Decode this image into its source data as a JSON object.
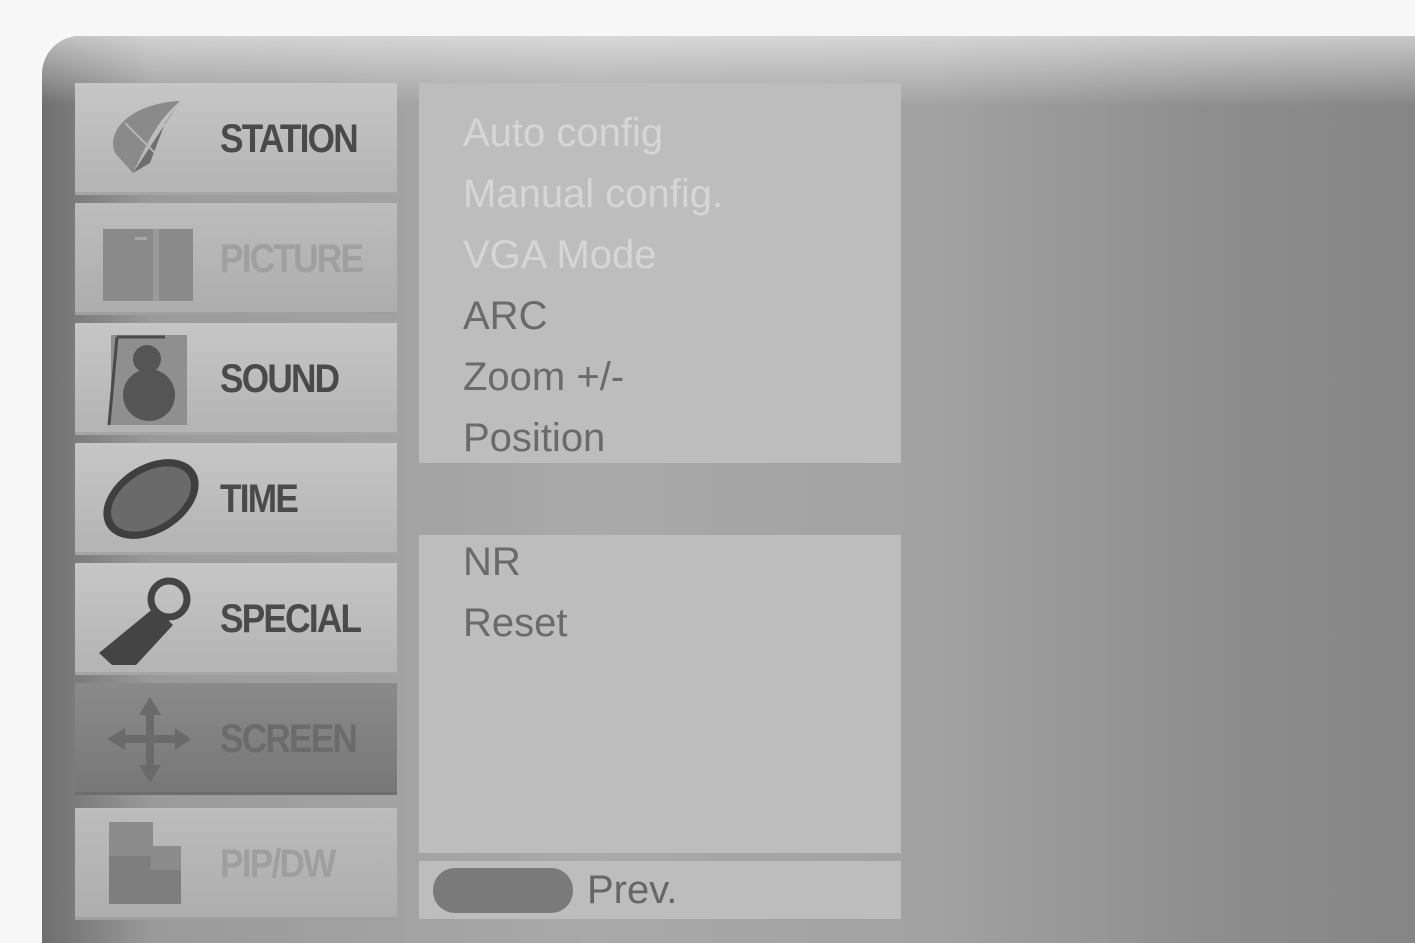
{
  "menu": {
    "items": [
      {
        "label": "STATION",
        "icon": "satellite-dish-icon",
        "state": "normal"
      },
      {
        "label": "PICTURE",
        "icon": "picture-monitor-icon",
        "state": "dim"
      },
      {
        "label": "SOUND",
        "icon": "speaker-icon",
        "state": "normal"
      },
      {
        "label": "TIME",
        "icon": "clock-disc-icon",
        "state": "normal"
      },
      {
        "label": "SPECIAL",
        "icon": "tag-icon",
        "state": "normal"
      },
      {
        "label": "SCREEN",
        "icon": "move-arrows-icon",
        "state": "active"
      },
      {
        "label": "PIP/DW",
        "icon": "pip-windows-icon",
        "state": "dim"
      }
    ]
  },
  "submenu": {
    "items": [
      {
        "label": "Auto config",
        "faded": true
      },
      {
        "label": "Manual config.",
        "faded": true
      },
      {
        "label": "VGA Mode",
        "faded": true
      },
      {
        "label": "ARC",
        "faded": false
      },
      {
        "label": "Zoom +/-",
        "faded": false
      },
      {
        "label": "Position",
        "faded": false
      }
    ],
    "extra_items": [
      {
        "label": "NR"
      },
      {
        "label": "Reset"
      }
    ]
  },
  "footer": {
    "button_icon": "menu-button-icon",
    "prev_label": "Prev."
  }
}
